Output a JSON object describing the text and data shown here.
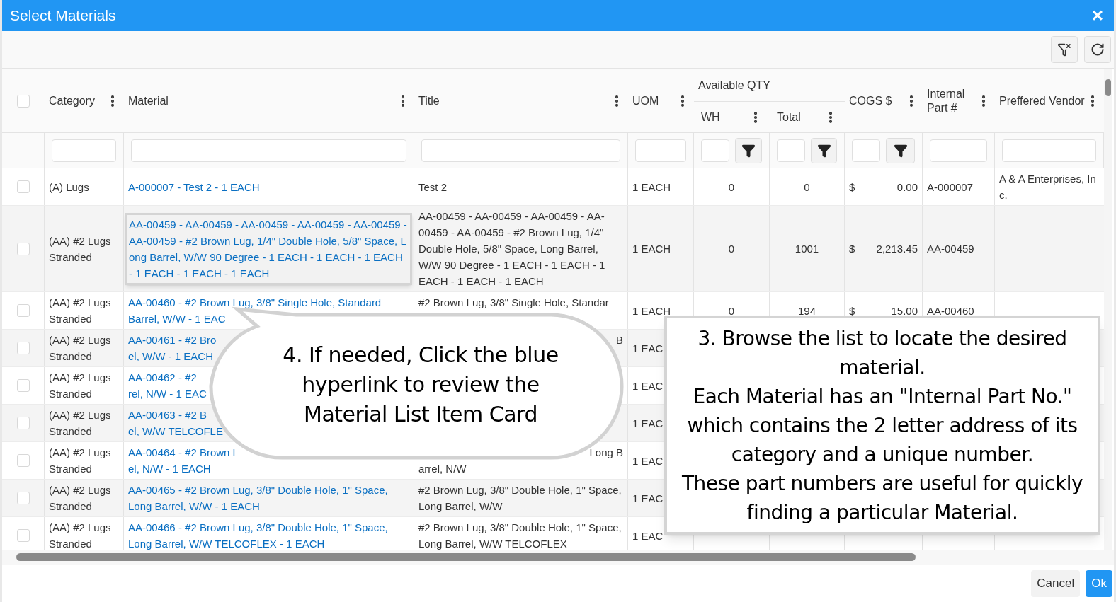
{
  "window": {
    "title": "Select Materials",
    "close": "×"
  },
  "toolbar": {
    "buttons": [
      {
        "kind": "clear-filter"
      },
      {
        "kind": "refresh"
      }
    ]
  },
  "table": {
    "header_checkbox": {
      "checked": false
    },
    "columns": [
      {
        "label": "Category"
      },
      {
        "label": "Material"
      },
      {
        "label": "Title"
      },
      {
        "label": "UOM"
      },
      {
        "group": "Available QTY",
        "children": [
          {
            "label": "WH"
          },
          {
            "label": "Total"
          }
        ]
      },
      {
        "label": "COGS $"
      },
      {
        "label": "Internal Part #"
      },
      {
        "label": "Preffered Vendor"
      }
    ],
    "filters": [
      {
        "kind": "text"
      },
      {
        "kind": "text"
      },
      {
        "kind": "text"
      },
      {
        "kind": "text"
      },
      {
        "kind": "numeric"
      },
      {
        "kind": "numeric"
      },
      {
        "kind": "numeric"
      },
      {
        "kind": "text"
      },
      {
        "kind": "text"
      }
    ],
    "rows": [
      {
        "checked": false,
        "highlighted": false,
        "category": "(A) Lugs",
        "material": "A-000007 - Test 2 - 1 EACH",
        "title": "Test 2",
        "uom": "1 EACH",
        "wh": "0",
        "total": "0",
        "cogs_symbol": "$",
        "cogs": "0.00",
        "internal_part": "A-000007",
        "vendor": "A & A Enterprises, Inc."
      },
      {
        "checked": false,
        "highlighted": true,
        "category": "(AA) #2 Lugs Stranded",
        "material": "AA-00459 - AA-00459 - AA-00459 - AA-00459 - AA-00459 - AA-00459 - #2 Brown Lug, 1/4\" Double Hole, 5/8\" Space, Long Barrel, W/W 90 Degree - 1 EACH - 1 EACH - 1 EACH - 1 EACH - 1 EACH - 1 EACH",
        "title": "AA-00459 - AA-00459 - AA-00459 - AA-00459 - AA-00459 - #2 Brown Lug, 1/4\" Double Hole, 5/8\" Space, Long Barrel, W/W 90 Degree - 1 EACH - 1 EACH - 1 EACH - 1 EACH - 1 EACH",
        "uom": "1 EACH",
        "wh": "0",
        "total": "1001",
        "cogs_symbol": "$",
        "cogs": "2,213.45",
        "internal_part": "AA-00459"
      },
      {
        "checked": false,
        "highlighted": false,
        "category": "(AA) #2 Lugs Stranded",
        "material": {
          "lines": [
            "AA-00460 - #2 Brown Lug, 3/8\" Single Hole, Standard",
            "Barrel, W/W - 1 EAC"
          ]
        },
        "title": {
          "lines": [
            "#2 Brown Lug, 3/8\" Single Hole, Standar"
          ]
        },
        "uom": "1 EACH",
        "wh": "0",
        "total": "194",
        "cogs_symbol": "$",
        "cogs": "15.00",
        "internal_part": "AA-00460"
      },
      {
        "checked": false,
        "highlighted": false,
        "category": "(AA) #2 Lugs Stranded",
        "material": {
          "lines": [
            "AA-00461 - #2 Bro",
            "el, W/W - 1 EACH"
          ]
        },
        "title": {
          "lines": [
            "B"
          ],
          "end_first": true
        },
        "uom": "1 EAC"
      },
      {
        "checked": false,
        "highlighted": false,
        "category": "(AA) #2 Lugs Stranded",
        "material": {
          "lines": [
            "AA-00462 - #2",
            "rel, N/W - 1 EAC"
          ]
        },
        "uom": "1 EAC"
      },
      {
        "checked": false,
        "highlighted": false,
        "category": "(AA) #2 Lugs Stranded",
        "material": {
          "lines": [
            "AA-00463 - #2 B",
            "el, W/W TELCOFLE"
          ]
        },
        "uom": "1 EAC"
      },
      {
        "checked": false,
        "highlighted": false,
        "category": "(AA) #2 Lugs Stranded",
        "material": {
          "lines": [
            "AA-00464 - #2 Brown L",
            "el, N/W - 1 EACH"
          ]
        },
        "title": {
          "lines": [
            "Long B",
            "arrel, N/W"
          ],
          "end_first": true
        },
        "uom": "1 EAC"
      },
      {
        "checked": false,
        "highlighted": false,
        "category": "(AA) #2 Lugs Stranded",
        "material": "AA-00465 - #2 Brown Lug, 3/8\" Double Hole, 1\" Space, Long Barrel, W/W - 1 EACH",
        "title": "#2 Brown Lug, 3/8\" Double Hole, 1\" Space, Long Barrel, W/W",
        "uom": "1 EAC"
      },
      {
        "checked": false,
        "highlighted": false,
        "category": "(AA) #2 Lugs Stranded",
        "material": "AA-00466 - #2 Brown Lug, 3/8\" Double Hole, 1\" Space, Long Barrel, W/W TELCOFLEX - 1 EACH",
        "title": "#2 Brown Lug, 3/8\" Double Hole, 1\" Space, Long Barrel, W/W TELCOFLEX",
        "uom": "1 EAC"
      }
    ]
  },
  "callouts": [
    {
      "kind": "bubble",
      "text": "4. If needed, Click the blue\nhyperlink to review the\nMaterial List Item Card"
    },
    {
      "kind": "box",
      "text": "3. Browse the list to locate the desired material.\nEach Material has an \"Internal Part No.\" which contains the 2 letter address of its category and a unique number.\nThese part numbers are useful for quickly finding a particular Material."
    }
  ],
  "footer": {
    "buttons": [
      {
        "label": "Cancel",
        "kind": "secondary"
      },
      {
        "label": "Ok",
        "kind": "primary"
      }
    ]
  }
}
